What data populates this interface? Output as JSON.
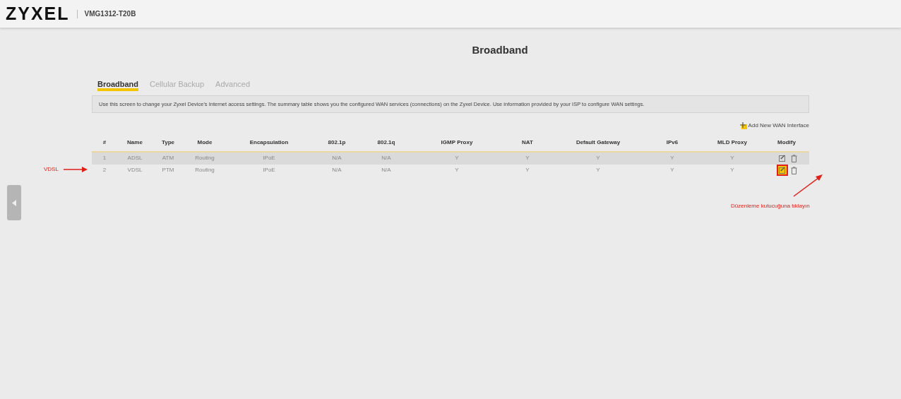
{
  "header": {
    "logo": "ZYXEL",
    "model": "VMG1312-T20B"
  },
  "page_title": "Broadband",
  "tabs": [
    {
      "label": "Broadband",
      "selected": true
    },
    {
      "label": "Cellular Backup",
      "selected": false
    },
    {
      "label": "Advanced",
      "selected": false
    }
  ],
  "description": "Use this screen to change your Zyxel Device's Internet access settings. The summary table shows you the configured WAN services (connections) on the Zyxel Device. Use information provided by your ISP to configure WAN settings.",
  "add_link": "Add New WAN Interface",
  "table": {
    "columns": [
      "#",
      "Name",
      "Type",
      "Mode",
      "Encapsulation",
      "802.1p",
      "802.1q",
      "IGMP Proxy",
      "NAT",
      "Default Gateway",
      "IPv6",
      "MLD Proxy",
      "Modify"
    ],
    "rows": [
      {
        "cells": [
          "1",
          "ADSL",
          "ATM",
          "Routing",
          "IPoE",
          "N/A",
          "N/A",
          "Y",
          "Y",
          "Y",
          "Y",
          "Y"
        ],
        "edit_highlighted": false
      },
      {
        "cells": [
          "2",
          "VDSL",
          "PTM",
          "Routing",
          "IPoE",
          "N/A",
          "N/A",
          "Y",
          "Y",
          "Y",
          "Y",
          "Y"
        ],
        "edit_highlighted": true
      }
    ]
  },
  "annotations": {
    "row_label": "VDSL",
    "callout": "Düzenleme kutucuğuna tıklayın"
  }
}
